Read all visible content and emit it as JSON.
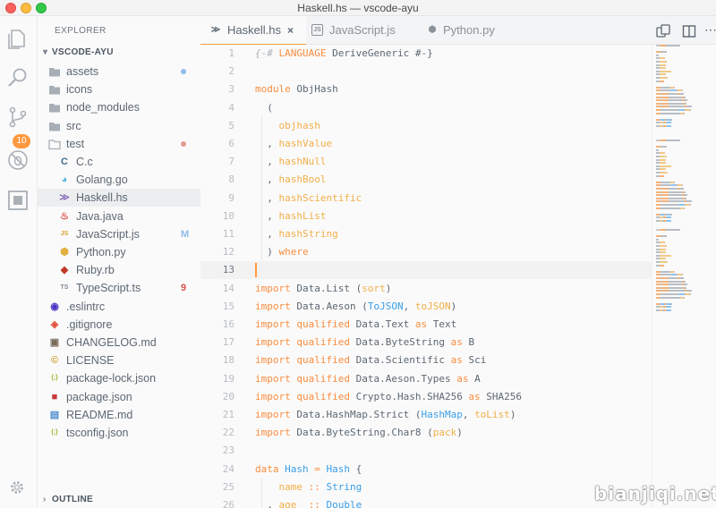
{
  "window": {
    "title": "Haskell.hs — vscode-ayu"
  },
  "activity_bar": {
    "items": [
      {
        "name": "explorer-icon"
      },
      {
        "name": "search-icon"
      },
      {
        "name": "source-control-icon",
        "badge": "10"
      },
      {
        "name": "debug-icon"
      },
      {
        "name": "extensions-icon"
      },
      {
        "name": "settings-gear-icon"
      }
    ]
  },
  "sidebar": {
    "header": "EXPLORER",
    "section": "VSCODE-AYU",
    "outline": "OUTLINE",
    "items": [
      {
        "label": "assets",
        "icon": "folder-icon",
        "indent": 0,
        "status_dot": "#8fbcea"
      },
      {
        "label": "icons",
        "icon": "folder-icon",
        "indent": 0
      },
      {
        "label": "node_modules",
        "icon": "folder-icon",
        "indent": 0
      },
      {
        "label": "src",
        "icon": "folder-icon",
        "indent": 0
      },
      {
        "label": "test",
        "icon": "folder-open-icon",
        "indent": 0,
        "status_dot": "#e09a8f"
      },
      {
        "label": "C.c",
        "icon": "c-icon",
        "glyph": "C",
        "color": "#3f6f8f",
        "indent": 1
      },
      {
        "label": "Golang.go",
        "icon": "golang-icon",
        "glyph": "◕",
        "color": "#4fb6d8",
        "indent": 1
      },
      {
        "label": "Haskell.hs",
        "icon": "haskell-icon",
        "glyph": "≫",
        "color": "#8a6fb8",
        "indent": 1,
        "selected": true
      },
      {
        "label": "Java.java",
        "icon": "java-icon",
        "glyph": "♨",
        "color": "#d9534f",
        "indent": 1
      },
      {
        "label": "JavaScript.js",
        "icon": "javascript-icon",
        "glyph": "JS",
        "color": "#d6a12b",
        "indent": 1,
        "tag": "M",
        "tag_color": "#8fbcea"
      },
      {
        "label": "Python.py",
        "icon": "python-icon",
        "glyph": "⬢",
        "color": "#e0b040",
        "indent": 1
      },
      {
        "label": "Ruby.rb",
        "icon": "ruby-icon",
        "glyph": "◆",
        "color": "#c0392b",
        "indent": 1
      },
      {
        "label": "TypeScript.ts",
        "icon": "typescript-icon",
        "glyph": "TS",
        "color": "#7f8c98",
        "indent": 1,
        "tag": "9",
        "tag_color": "#d9534f"
      },
      {
        "label": ".eslintrc",
        "icon": "eslint-icon",
        "glyph": "◉",
        "color": "#4b32c3",
        "indent": 0
      },
      {
        "label": ".gitignore",
        "icon": "git-icon",
        "glyph": "◈",
        "color": "#e0533d",
        "indent": 0
      },
      {
        "label": "CHANGELOG.md",
        "icon": "changelog-icon",
        "glyph": "▣",
        "color": "#7a6a5a",
        "indent": 0
      },
      {
        "label": "LICENSE",
        "icon": "license-icon",
        "glyph": "©",
        "color": "#d0a030",
        "indent": 0
      },
      {
        "label": "package-lock.json",
        "icon": "json-icon",
        "glyph": "{;}",
        "color": "#a0b830",
        "indent": 0
      },
      {
        "label": "package.json",
        "icon": "npm-icon",
        "glyph": "■",
        "color": "#cb3837",
        "indent": 0
      },
      {
        "label": "README.md",
        "icon": "readme-icon",
        "glyph": "▤",
        "color": "#4f8fcf",
        "indent": 0
      },
      {
        "label": "tsconfig.json",
        "icon": "json-icon",
        "glyph": "{;}",
        "color": "#a0b830",
        "indent": 0
      }
    ]
  },
  "tabs": [
    {
      "label": "Haskell.hs",
      "icon": "haskell-icon",
      "glyph": "≫",
      "color": "#8a6fb8",
      "active": true,
      "close": "×"
    },
    {
      "label": "JavaScript.js",
      "icon": "javascript-icon",
      "glyph": "JS",
      "color": "#d6a12b"
    },
    {
      "label": "Python.py",
      "icon": "python-icon",
      "glyph": "⬢",
      "color": "#e0b040"
    }
  ],
  "editor": {
    "current_line": 13,
    "lines": [
      {
        "n": "1",
        "tokens": [
          [
            "c",
            "{-# "
          ],
          [
            "k",
            "LANGUAGE"
          ],
          [
            "",
            " DeriveGeneric #-}"
          ]
        ]
      },
      {
        "n": "2",
        "tokens": []
      },
      {
        "n": "3",
        "tokens": [
          [
            "k",
            "module"
          ],
          [
            "",
            " ObjHash"
          ]
        ]
      },
      {
        "n": "4",
        "tokens": [
          [
            "",
            "  ("
          ]
        ]
      },
      {
        "n": "5",
        "tokens": [
          [
            "",
            "    "
          ],
          [
            "f",
            "objhash"
          ]
        ]
      },
      {
        "n": "6",
        "tokens": [
          [
            "",
            "  , "
          ],
          [
            "f",
            "hashValue"
          ]
        ]
      },
      {
        "n": "7",
        "tokens": [
          [
            "",
            "  , "
          ],
          [
            "f",
            "hashNull"
          ]
        ]
      },
      {
        "n": "8",
        "tokens": [
          [
            "",
            "  , "
          ],
          [
            "f",
            "hashBool"
          ]
        ]
      },
      {
        "n": "9",
        "tokens": [
          [
            "",
            "  , "
          ],
          [
            "f",
            "hashScientific"
          ]
        ]
      },
      {
        "n": "10",
        "tokens": [
          [
            "",
            "  , "
          ],
          [
            "f",
            "hashList"
          ]
        ]
      },
      {
        "n": "11",
        "tokens": [
          [
            "",
            "  , "
          ],
          [
            "f",
            "hashString"
          ]
        ]
      },
      {
        "n": "12",
        "tokens": [
          [
            "",
            "  ) "
          ],
          [
            "k",
            "where"
          ]
        ]
      },
      {
        "n": "13",
        "tokens": []
      },
      {
        "n": "14",
        "tokens": [
          [
            "k",
            "import"
          ],
          [
            "",
            " Data.List ("
          ],
          [
            "f",
            "sort"
          ],
          [
            "",
            ")"
          ]
        ]
      },
      {
        "n": "15",
        "tokens": [
          [
            "k",
            "import"
          ],
          [
            "",
            " Data.Aeson ("
          ],
          [
            "t",
            "ToJSON"
          ],
          [
            "",
            ", "
          ],
          [
            "f",
            "toJSON"
          ],
          [
            "",
            ")"
          ]
        ]
      },
      {
        "n": "16",
        "tokens": [
          [
            "k",
            "import"
          ],
          [
            "",
            " "
          ],
          [
            "k",
            "qualified"
          ],
          [
            "",
            " Data.Text "
          ],
          [
            "k",
            "as"
          ],
          [
            "",
            " Text"
          ]
        ]
      },
      {
        "n": "17",
        "tokens": [
          [
            "k",
            "import"
          ],
          [
            "",
            " "
          ],
          [
            "k",
            "qualified"
          ],
          [
            "",
            " Data.ByteString "
          ],
          [
            "k",
            "as"
          ],
          [
            "",
            " B"
          ]
        ]
      },
      {
        "n": "18",
        "tokens": [
          [
            "k",
            "import"
          ],
          [
            "",
            " "
          ],
          [
            "k",
            "qualified"
          ],
          [
            "",
            " Data.Scientific "
          ],
          [
            "k",
            "as"
          ],
          [
            "",
            " Sci"
          ]
        ]
      },
      {
        "n": "19",
        "tokens": [
          [
            "k",
            "import"
          ],
          [
            "",
            " "
          ],
          [
            "k",
            "qualified"
          ],
          [
            "",
            " Data.Aeson.Types "
          ],
          [
            "k",
            "as"
          ],
          [
            "",
            " A"
          ]
        ]
      },
      {
        "n": "20",
        "tokens": [
          [
            "k",
            "import"
          ],
          [
            "",
            " "
          ],
          [
            "k",
            "qualified"
          ],
          [
            "",
            " Crypto.Hash.SHA256 "
          ],
          [
            "k",
            "as"
          ],
          [
            "",
            " SHA256"
          ]
        ]
      },
      {
        "n": "21",
        "tokens": [
          [
            "k",
            "import"
          ],
          [
            "",
            " Data.HashMap.Strict ("
          ],
          [
            "t",
            "HashMap"
          ],
          [
            "",
            ", "
          ],
          [
            "f",
            "toList"
          ],
          [
            "",
            ")"
          ]
        ]
      },
      {
        "n": "22",
        "tokens": [
          [
            "k",
            "import"
          ],
          [
            "",
            " Data.ByteString.Char8 ("
          ],
          [
            "f",
            "pack"
          ],
          [
            "",
            ")"
          ]
        ]
      },
      {
        "n": "23",
        "tokens": []
      },
      {
        "n": "24",
        "tokens": [
          [
            "k",
            "data"
          ],
          [
            "",
            " "
          ],
          [
            "t",
            "Hash"
          ],
          [
            "",
            " "
          ],
          [
            "k",
            "="
          ],
          [
            "",
            " "
          ],
          [
            "t",
            "Hash"
          ],
          [
            "",
            " {"
          ]
        ]
      },
      {
        "n": "25",
        "tokens": [
          [
            "",
            "    "
          ],
          [
            "f",
            "name"
          ],
          [
            "",
            " "
          ],
          [
            "k",
            "::"
          ],
          [
            "",
            " "
          ],
          [
            "t",
            "String"
          ]
        ]
      },
      {
        "n": "26",
        "tokens": [
          [
            "",
            "  , "
          ],
          [
            "f",
            "age"
          ],
          [
            "",
            "  "
          ],
          [
            "k",
            "::"
          ],
          [
            "",
            " "
          ],
          [
            "t",
            "Double"
          ]
        ]
      }
    ]
  },
  "watermark": "bianjiqi.net"
}
